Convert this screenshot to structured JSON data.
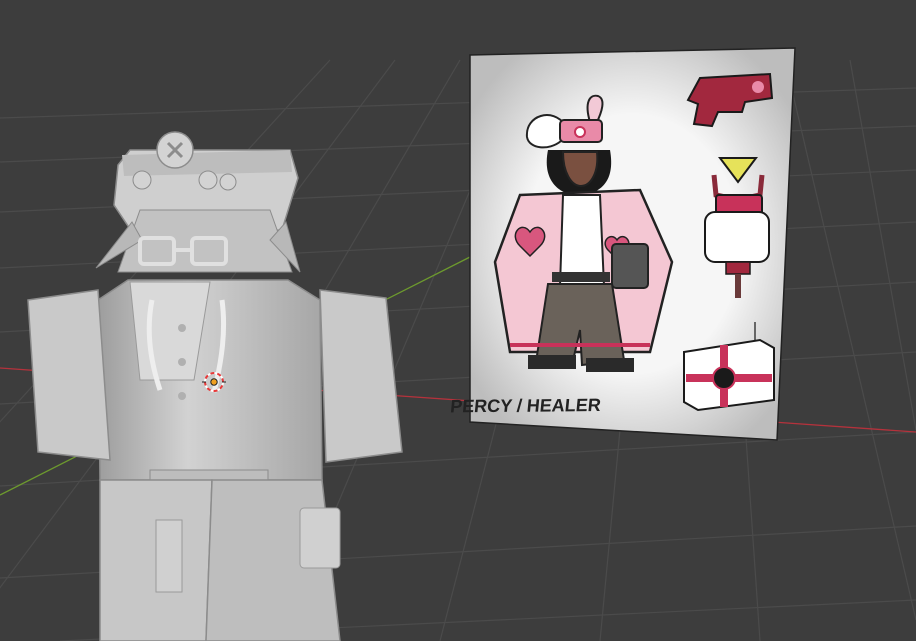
{
  "viewport": {
    "background": "#3d3d3d",
    "grid_color": "#4a4a4a",
    "x_axis_color": "#b5323c",
    "y_axis_color": "#6d9a2e"
  },
  "reference_card": {
    "caption": "PERCY / HEALER",
    "items": [
      "pistol-icon",
      "healing-totem-icon",
      "medkit-icon"
    ],
    "accent_color": "#c8325a"
  },
  "model": {
    "material_color": "#c8c8c8"
  },
  "gizmo": {
    "name": "3d-cursor-origin"
  }
}
